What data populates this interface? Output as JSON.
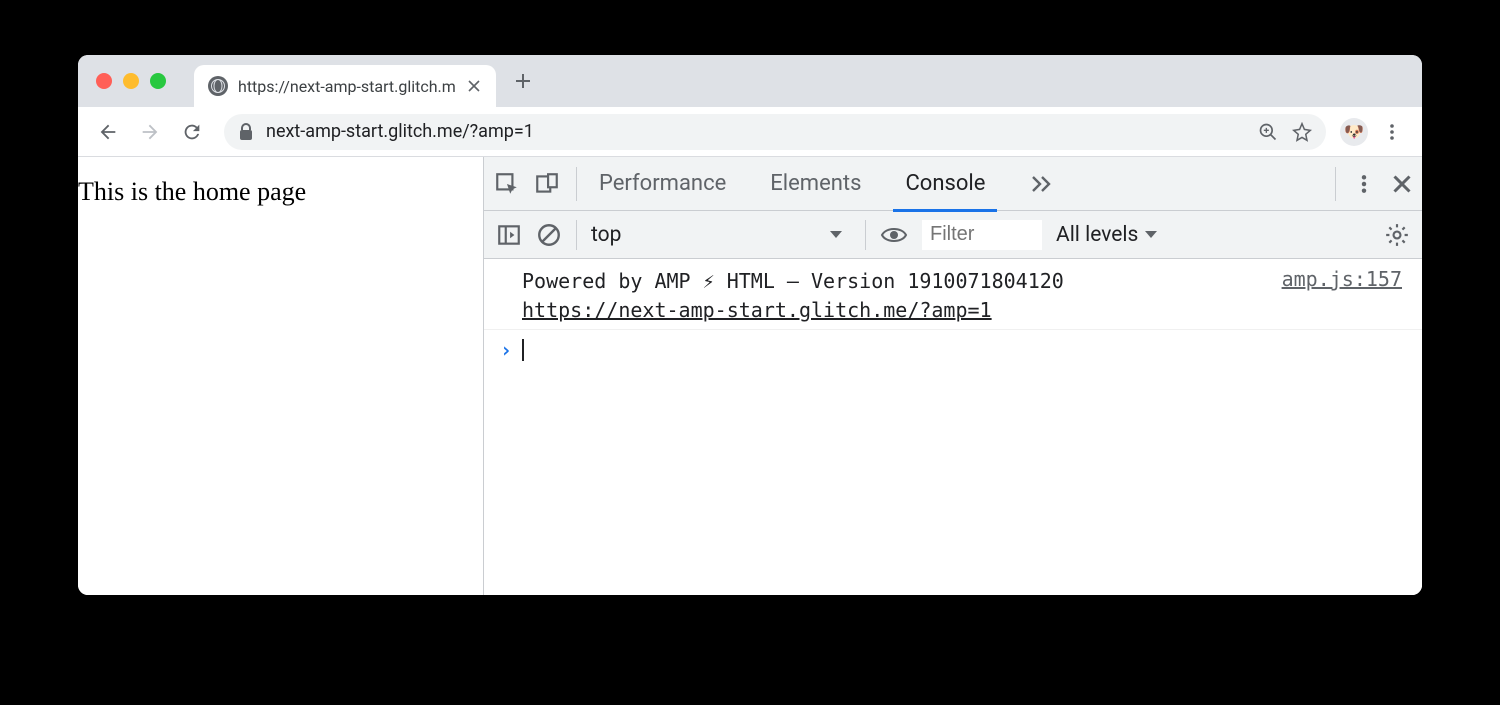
{
  "browser": {
    "tab_title": "https://next-amp-start.glitch.m",
    "url": "next-amp-start.glitch.me/?amp=1"
  },
  "page": {
    "body_text": "This is the home page"
  },
  "devtools": {
    "tabs": {
      "performance": "Performance",
      "elements": "Elements",
      "console": "Console"
    },
    "console_toolbar": {
      "context": "top",
      "filter_placeholder": "Filter",
      "levels": "All levels"
    },
    "console": {
      "message": "Powered by AMP ⚡ HTML – Version 1910071804120",
      "message_url": "https://next-amp-start.glitch.me/?amp=1",
      "source": "amp.js:157"
    }
  }
}
